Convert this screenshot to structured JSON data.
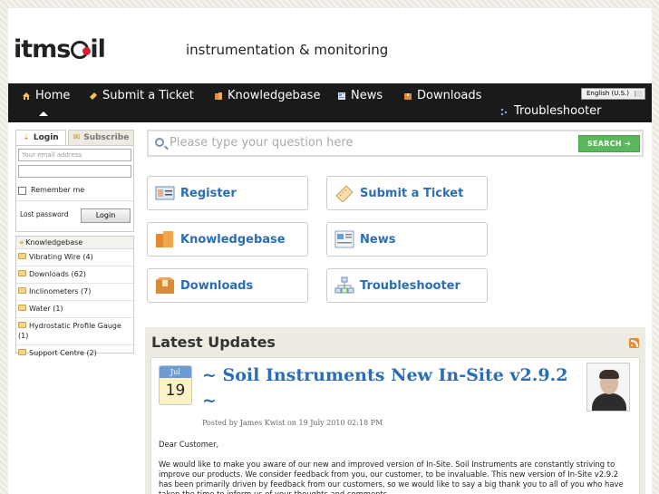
{
  "header": {
    "logo_text": "itmsoil",
    "tagline": "instrumentation & monitoring"
  },
  "nav": {
    "items": [
      {
        "label": "Home",
        "icon": "house-icon",
        "active": true
      },
      {
        "label": "Submit a Ticket",
        "icon": "ticket-icon"
      },
      {
        "label": "Knowledgebase",
        "icon": "books-icon"
      },
      {
        "label": "News",
        "icon": "news-icon"
      },
      {
        "label": "Downloads",
        "icon": "download-box-icon"
      },
      {
        "label": "Troubleshooter",
        "icon": "troubleshooter-icon"
      }
    ],
    "language": "English (U.S.)"
  },
  "login": {
    "tab_login": "Login",
    "tab_subscribe": "Subscribe",
    "email_placeholder": "Your email address",
    "password_value": "",
    "remember_label": "Remember me",
    "lost_password": "Lost password",
    "login_button": "Login"
  },
  "knowledgebase": {
    "title": "Knowledgebase",
    "items": [
      {
        "label": "Vibrating Wire",
        "count": "(4)"
      },
      {
        "label": "Downloads",
        "count": "(62)"
      },
      {
        "label": "Inclinometers",
        "count": "(7)"
      },
      {
        "label": "Water",
        "count": "(1)"
      },
      {
        "label": "Hydrostatic Profile Gauge",
        "count": "(1)"
      },
      {
        "label": "Support Centre",
        "count": "(2)"
      }
    ]
  },
  "search": {
    "placeholder": "Please type your question here",
    "button": "SEARCH"
  },
  "tiles": [
    {
      "label": "Register",
      "icon": "register-card-icon"
    },
    {
      "label": "Submit a Ticket",
      "icon": "ticket-icon"
    },
    {
      "label": "Knowledgebase",
      "icon": "books-icon"
    },
    {
      "label": "News",
      "icon": "news-icon"
    },
    {
      "label": "Downloads",
      "icon": "download-box-icon"
    },
    {
      "label": "Troubleshooter",
      "icon": "troubleshooter-icon"
    }
  ],
  "latest": {
    "title": "Latest Updates",
    "article": {
      "month": "Jul",
      "day": "19",
      "title": "~ Soil Instruments New In-Site v2.9.2 ~",
      "meta": "Posted by James Kwist on 19 July 2010 02:18 PM",
      "greeting": "Dear Customer,",
      "body": "We would like to make you aware of our new and improved version of In-Site. Soil Instruments are constantly striving to improve our products. We consider feedback from you, our customer, to be invaluable. This new version of In-Site v2.9.2 has been primarily driven by feedback from our customers, so we would like to say a big thank you to all of you who have taken the time to inform us of your thoughts and comments."
    }
  },
  "colors": {
    "nav_bg": "#1a1a1a",
    "link_blue": "#2a6db6",
    "search_green": "#5cb85c",
    "logo_red": "#d6202c"
  }
}
